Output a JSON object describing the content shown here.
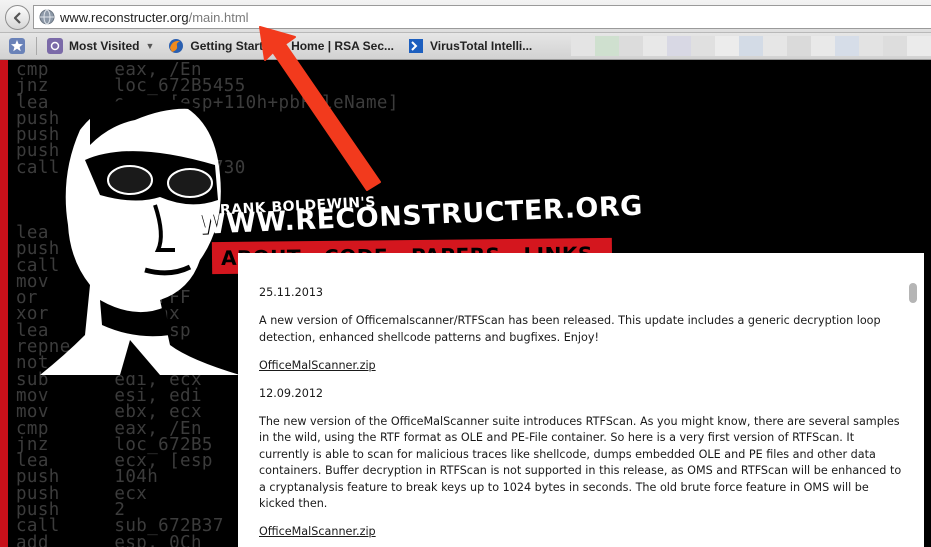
{
  "browser": {
    "url_host": "www.reconstructer.org",
    "url_path": "/main.html",
    "bookmarks": [
      {
        "label": "Most Visited",
        "icon": "most-visited-icon",
        "dropdown": true
      },
      {
        "label": "Getting Started",
        "icon": "firefox-icon"
      },
      {
        "label": "Home | RSA Sec...",
        "icon": "rsa-icon"
      },
      {
        "label": "VirusTotal Intelli...",
        "icon": "virustotal-icon"
      }
    ]
  },
  "site": {
    "owner": "FRANK BOLDEWIN'S",
    "name": "WWW.RECONSTRUCTER.ORG",
    "nav": [
      "ABOUT",
      "CODE",
      "PAPERS",
      "LINKS"
    ]
  },
  "background_code": [
    "cmp      eax, /En",
    "jnz      loc_672B5455",
    "lea      ecx, [esp+110h+pbFileName]",
    "push     ecx",
    "push     edx",
    "push     2",
    "call     sub_672B3730",
    "         0Ch",
    "",
    "",
    "lea      [",
    "push",
    "call     sub_67_",
    "mov      ,  off",
    "or       ,  0FFF",
    "xor      ,  eax",
    "lea      ,  [esp",
    "repne scas",
    "not      ecx",
    "sub      edi, ecx",
    "mov      esi, edi",
    "mov      ebx, ecx",
    "cmp      eax, /En",
    "jnz      loc_672B5",
    "lea      ecx, [esp",
    "push     104h",
    "push     ecx",
    "push     2",
    "call     sub_672B37",
    "add      esp, 0Ch"
  ],
  "posts": [
    {
      "date": "25.11.2013",
      "text": "A new version of Officemalscanner/RTFScan has been released. This update includes a generic decryption loop detection, enhanced shellcode patterns and bugfixes. Enjoy!",
      "link": "OfficeMalScanner.zip"
    },
    {
      "date": "12.09.2012",
      "text": "The new version of the OfficeMalScanner suite introduces RTFScan. As you might know, there are several samples in the wild, using the RTF format as OLE and PE-File container. So here is a very first version of RTFScan. It currently is able to scan for malicious traces like shellcode, dumps embedded OLE and PE files and other data containers. Buffer decryption in RTFScan is not supported in this release, as OMS and RTFScan will be enhanced to a cryptanalysis feature to break keys up to 1024 bytes in seconds. The old brute force feature in OMS will be kicked then.",
      "link": "OfficeMalScanner.zip"
    }
  ],
  "colors": {
    "accent_red": "#d4161e",
    "annotation_arrow": "#f23a1d"
  }
}
